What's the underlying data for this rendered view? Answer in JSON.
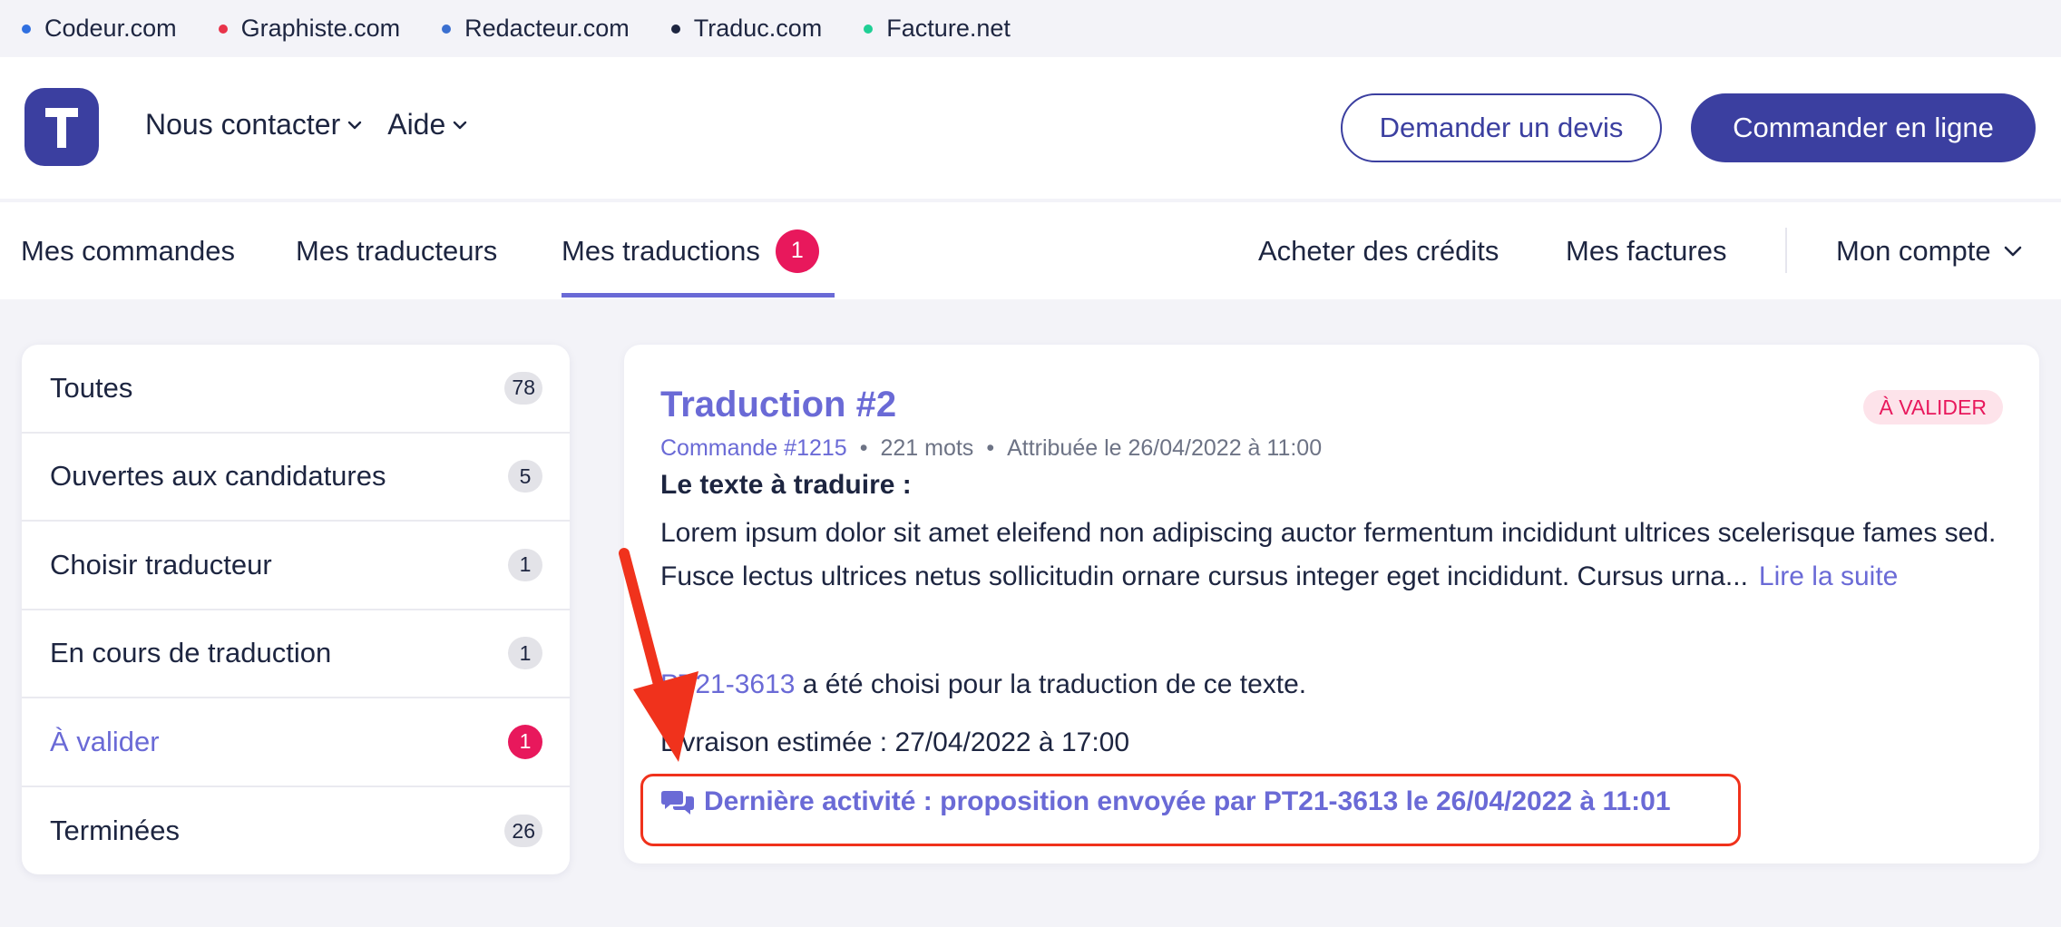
{
  "network": [
    {
      "label": "Codeur.com",
      "color": "#2f6fe0"
    },
    {
      "label": "Graphiste.com",
      "color": "#e8334a"
    },
    {
      "label": "Redacteur.com",
      "color": "#3a6fd0"
    },
    {
      "label": "Traduc.com",
      "color": "#1d2540"
    },
    {
      "label": "Facture.net",
      "color": "#1fcf95"
    }
  ],
  "header": {
    "logo_letter": "T",
    "nav": [
      {
        "label": "Nous contacter"
      },
      {
        "label": "Aide"
      }
    ],
    "quote_button": "Demander un devis",
    "order_button": "Commander en ligne"
  },
  "tabs": {
    "left": [
      {
        "label": "Mes commandes"
      },
      {
        "label": "Mes traducteurs"
      },
      {
        "label": "Mes traductions",
        "badge": "1"
      }
    ],
    "right": [
      {
        "label": "Acheter des crédits"
      },
      {
        "label": "Mes factures"
      },
      {
        "label": "Mon compte"
      }
    ]
  },
  "sidebar": {
    "items": [
      {
        "label": "Toutes",
        "count": "78"
      },
      {
        "label": "Ouvertes aux candidatures",
        "count": "5"
      },
      {
        "label": "Choisir traducteur",
        "count": "1"
      },
      {
        "label": "En cours de traduction",
        "count": "1"
      },
      {
        "label": "À valider",
        "count": "1"
      },
      {
        "label": "Terminées",
        "count": "26"
      }
    ]
  },
  "card": {
    "title": "Traduction #2",
    "status": "À VALIDER",
    "order_link": "Commande #1215",
    "words": "221 mots",
    "assigned": "Attribuée le 26/04/2022 à 11:00",
    "text_label": "Le texte à traduire :",
    "text_excerpt": "Lorem ipsum dolor sit amet eleifend non adipiscing auctor fermentum incididunt ultrices scelerisque fames sed. Fusce lectus ultrices netus sollicitudin ornare cursus integer eget incididunt. Cursus urna...",
    "read_more": "Lire la suite",
    "translator_link": "PT21-3613",
    "chosen_text": "a été choisi pour la traduction de ce texte.",
    "delivery": "Livraison estimée : 27/04/2022 à 17:00",
    "last_activity": "Dernière activité : proposition envoyée par PT21-3613 le 26/04/2022 à 11:01"
  },
  "colors": {
    "brand": "#3b3fa0",
    "accent": "#6a6ad6",
    "badge_red": "#e8185c",
    "annotation_red": "#f0321c"
  }
}
